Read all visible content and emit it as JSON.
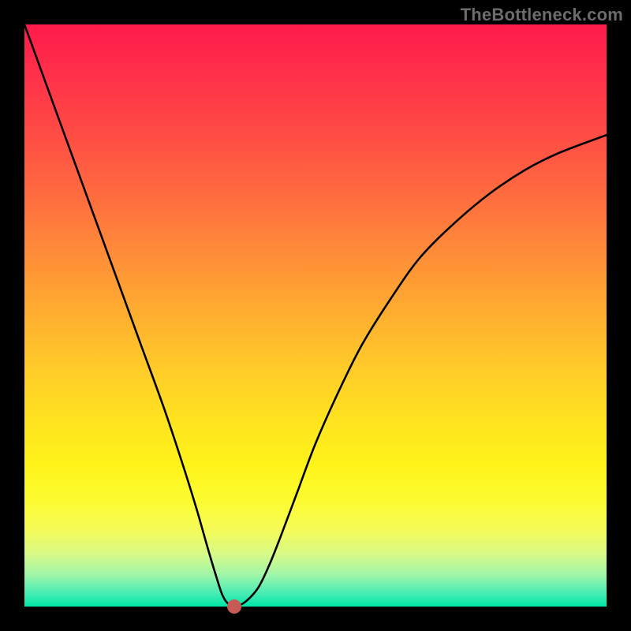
{
  "watermark": "TheBottleneck.com",
  "chart_data": {
    "type": "line",
    "title": "",
    "xlabel": "",
    "ylabel": "",
    "xlim": [
      0,
      100
    ],
    "ylim": [
      0,
      100
    ],
    "grid": false,
    "series": [
      {
        "name": "curve",
        "x": [
          0,
          4,
          8,
          12,
          16,
          20,
          24,
          27,
          29.5,
          31.5,
          33,
          34,
          35,
          36,
          37.5,
          40,
          42,
          44,
          47,
          50,
          54,
          58,
          63,
          68,
          74,
          80,
          86,
          92,
          100
        ],
        "y": [
          100,
          89,
          78,
          67,
          56,
          45,
          34,
          25,
          17,
          10,
          5,
          2,
          0.5,
          0.5,
          0.5,
          3,
          7,
          12,
          20,
          28,
          37,
          45,
          53,
          60,
          66,
          71,
          75,
          78,
          81
        ]
      }
    ],
    "marker": {
      "x": 36,
      "y": 0
    },
    "gradient_stops": [
      {
        "pos": 0,
        "color": "#ff1a4b"
      },
      {
        "pos": 0.5,
        "color": "#ffb733"
      },
      {
        "pos": 0.78,
        "color": "#fff41a"
      },
      {
        "pos": 1.0,
        "color": "#00e6a8"
      }
    ]
  }
}
